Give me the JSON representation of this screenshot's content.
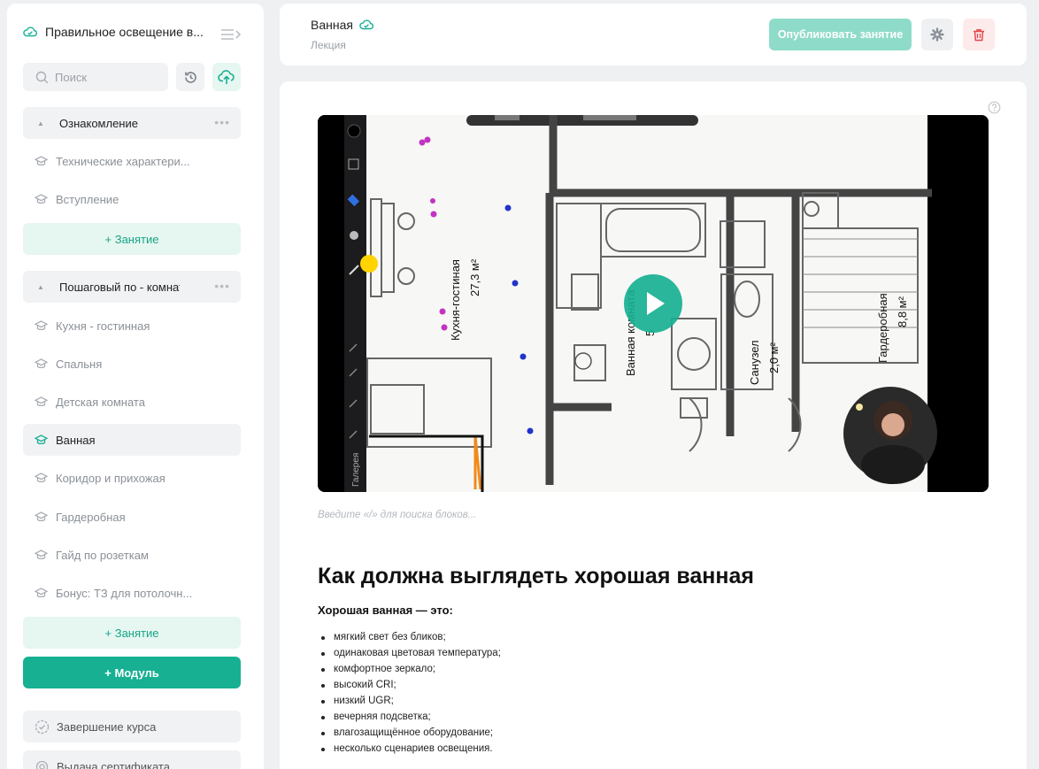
{
  "sidebar": {
    "course_title": "Правильное освещение в...",
    "search_placeholder": "Поиск",
    "modules": [
      {
        "title": "Ознакомление",
        "lessons": [
          "Технические характери...",
          "Вступление"
        ],
        "add_lesson_label": "+ Занятие"
      },
      {
        "title": "Пошаговый по - комнатам",
        "lessons": [
          "Кухня - гостинная",
          "Спальня",
          "Детская комната",
          "Ванная",
          "Коридор и прихожая",
          "Гардеробная",
          "Гайд по розеткам",
          "Бонус: ТЗ для потолочн..."
        ],
        "active_lesson": "Ванная",
        "add_lesson_label": "+ Занятие"
      }
    ],
    "add_module_label": "+ Модуль",
    "footer_items": [
      "Завершение курса",
      "Выдача сертификата"
    ]
  },
  "header": {
    "lesson_title": "Ванная",
    "lesson_type": "Лекция",
    "publish_label": "Опубликовать занятие"
  },
  "content": {
    "video": {
      "gallery_label": "Галерея",
      "room_labels": [
        "Кухня-гостиная",
        "27,3 м²",
        "Ванная комната",
        "5",
        "Санузел",
        "2,0 м²",
        "Гардеробная",
        "8,8 м²"
      ],
      "play_icon": "play-icon"
    },
    "block_placeholder": "Введите «/» для поиска блоков...",
    "heading": "Как должна выглядеть хорошая ванная",
    "subheading": "Хорошая ванная — это:",
    "bullets": [
      "мягкий свет без бликов;",
      "одинаковая цветовая температура;",
      "комфортное зеркало;",
      "высокий CRI;",
      "низкий UGR;",
      "вечерняя подсветка;",
      "влагозащищённое оборудование;",
      "несколько сценариев освещения."
    ]
  },
  "colors": {
    "accent": "#17b093",
    "accent_light": "#e6f6f0",
    "publish_disabled": "#8edbc9",
    "danger": "#e5484d"
  }
}
